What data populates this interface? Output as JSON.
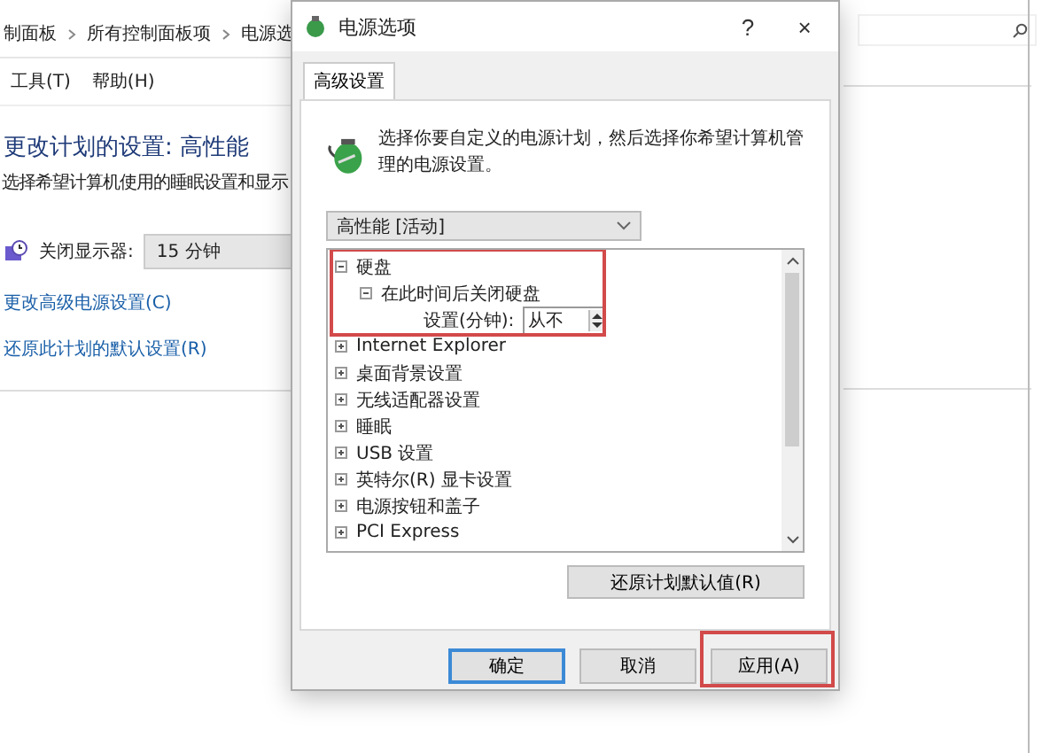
{
  "background_window": {
    "breadcrumb": [
      "制面板",
      "所有控制面板项",
      "电源选"
    ],
    "menu": [
      "工具(T)",
      "帮助(H)"
    ],
    "title": "更改计划的设置: 高性能",
    "subtitle": "选择希望计算机使用的睡眠设置和显示",
    "display_off": {
      "label": "关闭显示器:",
      "value": "15 分钟"
    },
    "links": [
      "更改高级电源设置(C)",
      "还原此计划的默认设置(R)"
    ]
  },
  "dialog": {
    "title": "电源选项",
    "help": "?",
    "close": "×",
    "tabs": [
      {
        "label": "高级设置",
        "selected": true
      }
    ],
    "description": "选择你要自定义的电源计划，然后选择你希望计算机管理的电源设置。",
    "plan": "高性能 [活动]",
    "tree": [
      {
        "kind": "group",
        "label": "硬盘",
        "expanded": true,
        "children": [
          {
            "kind": "group",
            "label": "在此时间后关闭硬盘",
            "expanded": true,
            "children": [
              {
                "kind": "setting",
                "label": "设置(分钟):",
                "value": "从不"
              }
            ]
          }
        ]
      },
      {
        "kind": "group",
        "label": "Internet Explorer",
        "expanded": false
      },
      {
        "kind": "group",
        "label": "桌面背景设置",
        "expanded": false
      },
      {
        "kind": "group",
        "label": "无线适配器设置",
        "expanded": false
      },
      {
        "kind": "group",
        "label": "睡眠",
        "expanded": false
      },
      {
        "kind": "group",
        "label": "USB 设置",
        "expanded": false
      },
      {
        "kind": "group",
        "label": "英特尔(R) 显卡设置",
        "expanded": false
      },
      {
        "kind": "group",
        "label": "电源按钮和盖子",
        "expanded": false
      },
      {
        "kind": "group",
        "label": "PCI Express",
        "expanded": false
      }
    ],
    "restore_button": "还原计划默认值(R)",
    "buttons": [
      {
        "label": "确定",
        "kind": "default"
      },
      {
        "label": "取消",
        "kind": "normal"
      },
      {
        "label": "应用(A)",
        "kind": "normal"
      }
    ]
  }
}
